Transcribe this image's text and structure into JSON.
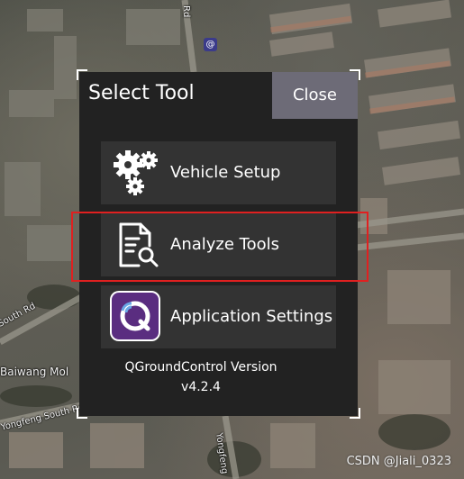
{
  "map": {
    "labels": {
      "rd_top": "Rd",
      "south_rd": "South Rd",
      "baiwang": "Baiwang Mol",
      "yongfeng_south": "Yongfeng South Rd",
      "yongfeng": "Yongfeng"
    },
    "marker_glyph": "@"
  },
  "dialog": {
    "title": "Select Tool",
    "close_label": "Close",
    "tools": [
      {
        "label": "Vehicle Setup",
        "icon": "gears-icon"
      },
      {
        "label": "Analyze Tools",
        "icon": "document-search-icon"
      },
      {
        "label": "Application Settings",
        "icon": "qgroundcontrol-app-icon"
      }
    ],
    "version_name": "QGroundControl Version",
    "version_number": "v4.2.4"
  },
  "annotation": {
    "highlight_color": "#e02020"
  },
  "watermark": "CSDN @Jiali_0323",
  "colors": {
    "dialog_bg": "#222222",
    "button_bg": "#333333",
    "close_bg": "#6d6b77",
    "app_icon_purple": "#5a2d80"
  }
}
